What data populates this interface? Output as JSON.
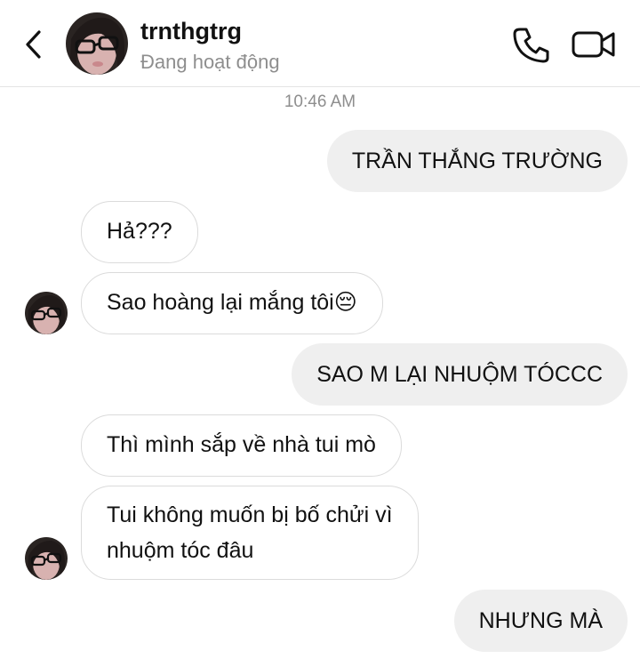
{
  "header": {
    "username": "trnthgtrg",
    "status": "Đang hoạt động",
    "icons": {
      "back": "chevron-left-icon",
      "call": "phone-icon",
      "video": "video-camera-icon"
    }
  },
  "thread": {
    "timestamp": "10:46 AM",
    "messages": [
      {
        "direction": "outgoing",
        "text": "TRẦN THẮNG TRƯỜNG"
      },
      {
        "direction": "incoming",
        "text": "Hả???"
      },
      {
        "direction": "incoming",
        "text": "Sao hoàng lại mắng tôi😔"
      },
      {
        "direction": "outgoing",
        "text": "SAO M LẠI NHUỘM TÓCCC"
      },
      {
        "direction": "incoming",
        "text": "Thì mình sắp về nhà tui mò"
      },
      {
        "direction": "incoming",
        "lines": [
          "Tui không muốn bị bố chửi vì",
          "nhuộm tóc đâu"
        ]
      },
      {
        "direction": "outgoing",
        "text": "NHƯNG MÀ"
      }
    ]
  },
  "colors": {
    "outgoing_bubble": "#efefef",
    "incoming_border": "#dbdbdb",
    "secondary_text": "#8e8e8e"
  }
}
